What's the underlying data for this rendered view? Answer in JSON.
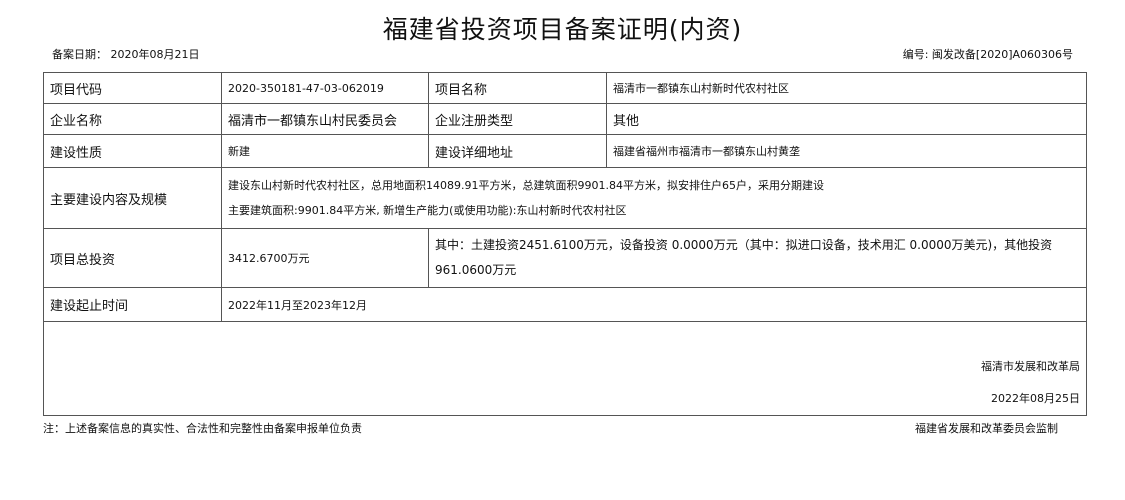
{
  "document": {
    "title": "福建省投资项目备案证明(内资)",
    "filing_date": "备案日期： 2020年08月21日",
    "number": "编号:   闽发改备[2020]A060306号"
  },
  "rows": {
    "project_code_label": "项目代码",
    "project_code_value": "2020-350181-47-03-062019",
    "project_name_label": "项目名称",
    "project_name_value": "福清市一都镇东山村新时代农村社区",
    "company_name_label": "企业名称",
    "company_name_value": "福清市一都镇东山村民委员会",
    "company_type_label": "企业注册类型",
    "company_type_value": "其他",
    "nature_label": "建设性质",
    "nature_value": "新建",
    "address_label": "建设详细地址",
    "address_value": "福建省福州市福清市一都镇东山村黄垄",
    "content_label": "主要建设内容及规模",
    "content_line1": "建设东山村新时代农村社区，总用地面积14089.91平方米，总建筑面积9901.84平方米，拟安排住户65户，采用分期建设",
    "content_line2": "主要建筑面积:9901.84平方米, 新增生产能力(或使用功能):东山村新时代农村社区",
    "investment_label": "项目总投资",
    "investment_total": "3412.6700万元",
    "investment_breakdown": "其中：土建投资2451.6100万元，设备投资 0.0000万元（其中：拟进口设备，技术用汇 0.0000万美元)，其他投资961.0600万元",
    "period_label": "建设起止时间",
    "period_value": "2022年11月至2023年12月"
  },
  "footer": {
    "organization": "福清市发展和改革局",
    "issue_date": "2022年08月25日"
  },
  "notes": {
    "disclaimer": "注：上述备案信息的真实性、合法性和完整性由备案申报单位负责",
    "supervisor": "福建省发展和改革委员会监制"
  }
}
